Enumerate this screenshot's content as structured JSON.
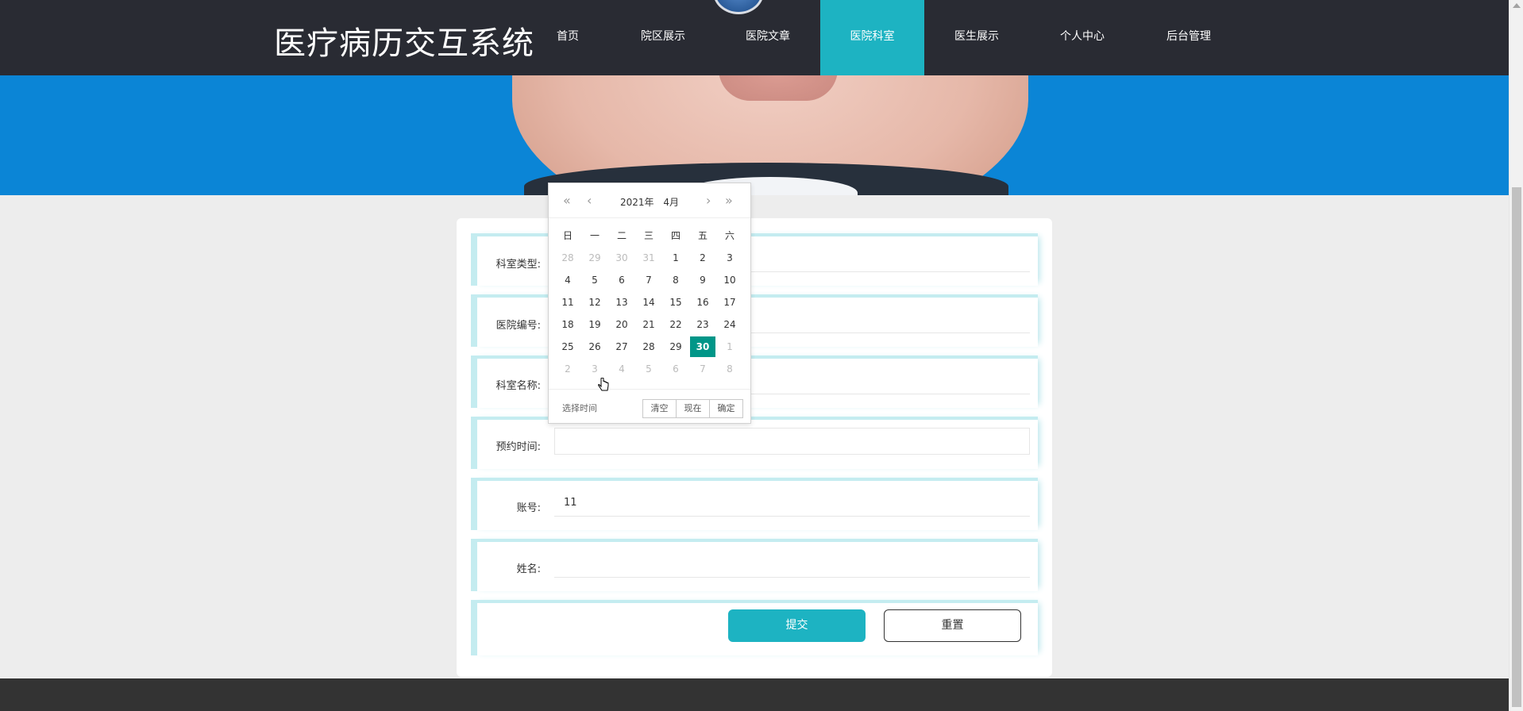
{
  "header": {
    "brand": "医疗病历交互系统",
    "nav": [
      {
        "label": "首页",
        "active": false
      },
      {
        "label": "院区展示",
        "active": false
      },
      {
        "label": "医院文章",
        "active": false
      },
      {
        "label": "医院科室",
        "active": true
      },
      {
        "label": "医生展示",
        "active": false
      },
      {
        "label": "个人中心",
        "active": false
      },
      {
        "label": "后台管理",
        "active": false
      }
    ]
  },
  "form": {
    "fields": [
      {
        "label": "科室类型:",
        "value": ""
      },
      {
        "label": "医院编号:",
        "value": ""
      },
      {
        "label": "科室名称:",
        "value": ""
      },
      {
        "label": "预约时间:",
        "value": ""
      },
      {
        "label": "账号:",
        "value": "11"
      },
      {
        "label": "姓名:",
        "value": ""
      }
    ],
    "submit_label": "提交",
    "reset_label": "重置"
  },
  "datepicker": {
    "year": "2021年",
    "month": "4月",
    "weekdays": [
      "日",
      "一",
      "二",
      "三",
      "四",
      "五",
      "六"
    ],
    "weeks": [
      [
        {
          "d": "28",
          "o": true
        },
        {
          "d": "29",
          "o": true
        },
        {
          "d": "30",
          "o": true
        },
        {
          "d": "31",
          "o": true
        },
        {
          "d": "1"
        },
        {
          "d": "2"
        },
        {
          "d": "3"
        }
      ],
      [
        {
          "d": "4"
        },
        {
          "d": "5"
        },
        {
          "d": "6"
        },
        {
          "d": "7"
        },
        {
          "d": "8"
        },
        {
          "d": "9"
        },
        {
          "d": "10"
        }
      ],
      [
        {
          "d": "11"
        },
        {
          "d": "12"
        },
        {
          "d": "13"
        },
        {
          "d": "14"
        },
        {
          "d": "15"
        },
        {
          "d": "16"
        },
        {
          "d": "17"
        }
      ],
      [
        {
          "d": "18"
        },
        {
          "d": "19"
        },
        {
          "d": "20"
        },
        {
          "d": "21"
        },
        {
          "d": "22"
        },
        {
          "d": "23"
        },
        {
          "d": "24"
        }
      ],
      [
        {
          "d": "25"
        },
        {
          "d": "26"
        },
        {
          "d": "27"
        },
        {
          "d": "28"
        },
        {
          "d": "29"
        },
        {
          "d": "30",
          "s": true
        },
        {
          "d": "1",
          "o": true
        }
      ],
      [
        {
          "d": "2",
          "o": true
        },
        {
          "d": "3",
          "o": true
        },
        {
          "d": "4",
          "o": true
        },
        {
          "d": "5",
          "o": true
        },
        {
          "d": "6",
          "o": true
        },
        {
          "d": "7",
          "o": true
        },
        {
          "d": "8",
          "o": true
        }
      ]
    ],
    "select_time_label": "选择时间",
    "clear_label": "清空",
    "now_label": "现在",
    "confirm_label": "确定",
    "selected_color": "#009688"
  },
  "colors": {
    "header_bg": "#292b33",
    "accent": "#1db3c2",
    "banner": "#0b85d6",
    "footer": "#333333"
  }
}
